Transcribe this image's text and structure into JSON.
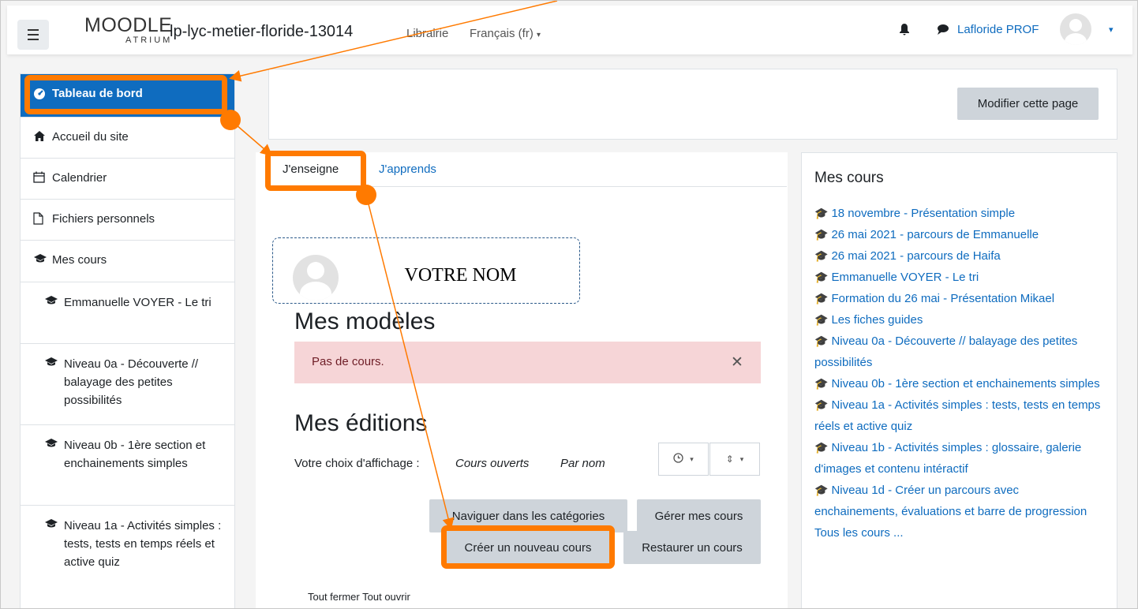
{
  "navbar": {
    "logo_main": "MOODLE",
    "logo_sub": "ATRIUM",
    "site_name": "lp-lyc-metier-floride-13014",
    "links": [
      "Librairie",
      "Français (fr)"
    ],
    "user_name": "Lafloride PROF"
  },
  "sidebar": {
    "items": [
      {
        "label": "Tableau de bord",
        "icon": "dashboard-icon"
      },
      {
        "label": "Accueil du site",
        "icon": "home-icon"
      },
      {
        "label": "Calendrier",
        "icon": "calendar-icon"
      },
      {
        "label": "Fichiers personnels",
        "icon": "file-icon"
      },
      {
        "label": "Mes cours",
        "icon": "graduation-cap-icon"
      },
      {
        "label": "Emmanuelle VOYER - Le tri",
        "icon": "graduation-cap-icon"
      },
      {
        "label": "Niveau 0a - Découverte // balayage des petites possibilités",
        "icon": "graduation-cap-icon"
      },
      {
        "label": "Niveau 0b - 1ère section et enchainements simples",
        "icon": "graduation-cap-icon"
      },
      {
        "label": "Niveau 1a - Activités simples : tests, tests en temps réels et active quiz",
        "icon": "graduation-cap-icon"
      }
    ]
  },
  "header_buttons": {
    "edit_page": "Modifier cette page"
  },
  "tabs": [
    "J'enseigne",
    "J'apprends"
  ],
  "profile": {
    "name_overlay": "VOTRE NOM"
  },
  "sections": {
    "models_title": "Mes modèles",
    "models_alert": "Pas de cours.",
    "editions_title": "Mes éditions",
    "display_choice_label": "Votre choix d'affichage :",
    "display_filter": "Cours ouverts",
    "display_sort": "Par nom",
    "collapse_all": "Tout fermer",
    "expand_all": "Tout ouvrir"
  },
  "actions": {
    "browse_categories": "Naviguer dans les catégories",
    "manage_courses": "Gérer mes cours",
    "create_course": "Créer un nouveau cours",
    "restore_course": "Restaurer un cours"
  },
  "my_courses_block": {
    "title": "Mes cours",
    "courses": [
      "18 novembre - Présentation simple",
      "26 mai 2021 - parcours de Emmanuelle",
      "26 mai 2021 - parcours de Haifa",
      "Emmanuelle VOYER - Le tri",
      "Formation du 26 mai - Présentation Mikael",
      "Les fiches guides",
      "Niveau 0a - Découverte // balayage des petites possibilités",
      "Niveau 0b - 1ère section et enchainements simples",
      "Niveau 1a - Activités simples : tests, tests en temps réels et active quiz",
      "Niveau 1b - Activités simples : glossaire, galerie d'images et contenu intéractif",
      "Niveau 1d - Créer un parcours avec enchainements, évaluations et barre de progression"
    ],
    "all_courses": "Tous les cours ..."
  },
  "colors": {
    "accent": "#0f6cbf",
    "annotation": "#ff7a00",
    "alert_bg": "#f6d5d7"
  }
}
